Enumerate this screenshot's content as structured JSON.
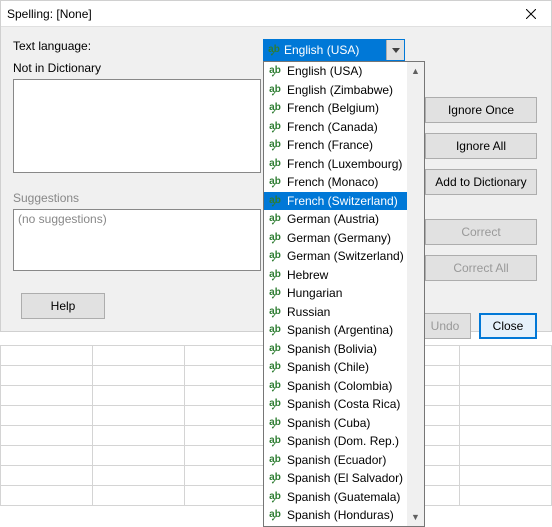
{
  "title": "Spelling: [None]",
  "labels": {
    "text_language": "Text language:",
    "not_in_dict": "Not in Dictionary",
    "suggestions": "Suggestions",
    "no_suggestions": "(no suggestions)"
  },
  "buttons": {
    "ignore_once": "Ignore Once",
    "ignore_all": "Ignore All",
    "add_dict": "Add to Dictionary",
    "correct": "Correct",
    "correct_all": "Correct All",
    "undo": "Undo",
    "close": "Close",
    "help": "Help"
  },
  "language": {
    "selected": "English (USA)",
    "highlighted": "French (Switzerland)",
    "options": [
      "English (USA)",
      "English (Zimbabwe)",
      "French (Belgium)",
      "French (Canada)",
      "French (France)",
      "French (Luxembourg)",
      "French (Monaco)",
      "French (Switzerland)",
      "German (Austria)",
      "German (Germany)",
      "German (Switzerland)",
      "Hebrew",
      "Hungarian",
      "Russian",
      "Spanish (Argentina)",
      "Spanish (Bolivia)",
      "Spanish (Chile)",
      "Spanish (Colombia)",
      "Spanish (Costa Rica)",
      "Spanish (Cuba)",
      "Spanish (Dom. Rep.)",
      "Spanish (Ecuador)",
      "Spanish (El Salvador)",
      "Spanish (Guatemala)",
      "Spanish (Honduras)"
    ]
  }
}
